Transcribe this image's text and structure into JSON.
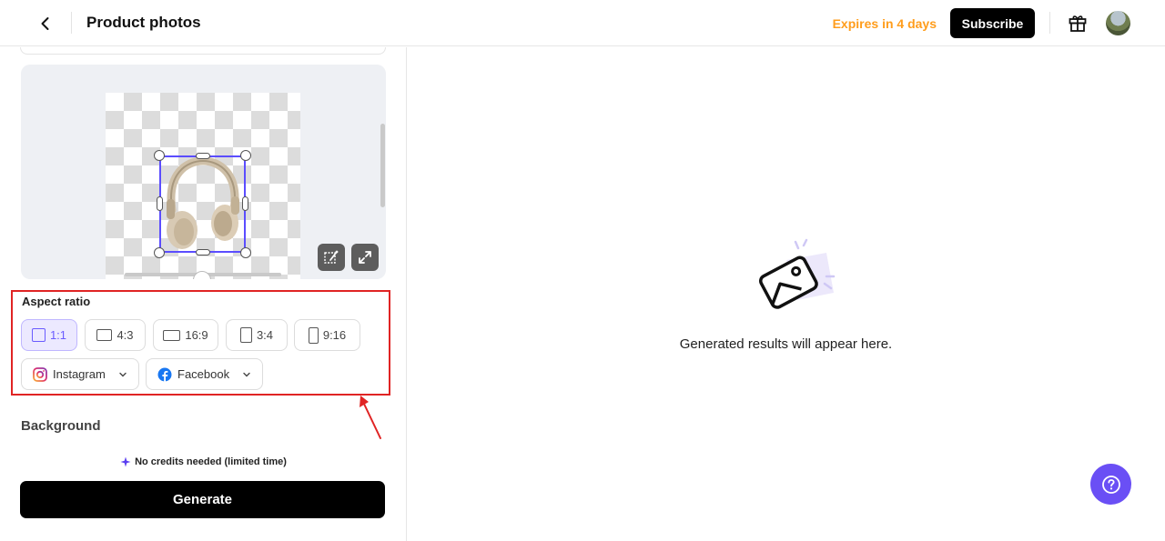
{
  "header": {
    "back_icon": "chevron-left-icon",
    "title": "Product photos",
    "expires": "Expires in 4 days",
    "subscribe_label": "Subscribe",
    "gift_icon": "gift-icon",
    "accent_color": "#ff9d1c"
  },
  "preview": {
    "tools": [
      "magic-edit-icon",
      "expand-icon"
    ],
    "selection_color": "#5b4dff"
  },
  "aspect_ratio": {
    "label": "Aspect ratio",
    "options": [
      {
        "label": "1:1",
        "selected": true
      },
      {
        "label": "4:3",
        "selected": false
      },
      {
        "label": "16:9",
        "selected": false
      },
      {
        "label": "3:4",
        "selected": false
      },
      {
        "label": "9:16",
        "selected": false
      }
    ],
    "socials": [
      {
        "label": "Instagram",
        "icon": "instagram-icon"
      },
      {
        "label": "Facebook",
        "icon": "facebook-icon"
      }
    ]
  },
  "background": {
    "label": "Background"
  },
  "generate": {
    "credits_note": "No credits needed (limited time)",
    "button_label": "Generate"
  },
  "results": {
    "empty_text": "Generated results will appear here."
  },
  "help": {
    "icon": "help-icon",
    "color": "#6a4ff5"
  }
}
